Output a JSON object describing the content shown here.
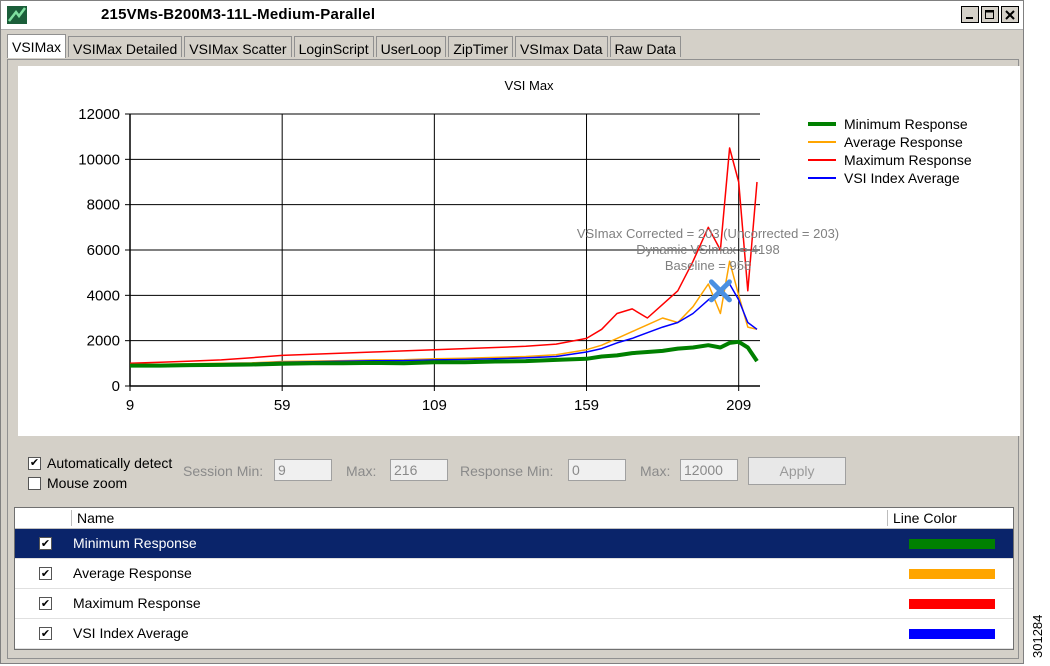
{
  "window": {
    "title": "215VMs-B200M3-11L-Medium-Parallel",
    "buttons": [
      "minimize-icon",
      "maximize-icon",
      "close-icon"
    ]
  },
  "tabs": [
    {
      "label": "VSIMax",
      "active": true
    },
    {
      "label": "VSIMax Detailed"
    },
    {
      "label": "VSIMax Scatter"
    },
    {
      "label": "LoginScript"
    },
    {
      "label": "UserLoop"
    },
    {
      "label": "ZipTimer"
    },
    {
      "label": "VSImax Data"
    },
    {
      "label": "Raw Data"
    }
  ],
  "chart_data": {
    "type": "line",
    "title": "VSI Max",
    "x_ticks": [
      9,
      59,
      109,
      159,
      209
    ],
    "y_ticks": [
      0,
      2000,
      4000,
      6000,
      8000,
      10000,
      12000
    ],
    "xlim": [
      9,
      216
    ],
    "ylim": [
      0,
      12000
    ],
    "grid": true,
    "legend_position": "top-right",
    "x": [
      9,
      19,
      29,
      39,
      49,
      59,
      69,
      79,
      89,
      99,
      109,
      119,
      129,
      139,
      149,
      159,
      164,
      169,
      174,
      179,
      184,
      189,
      194,
      199,
      203,
      206,
      209,
      212,
      215
    ],
    "series": [
      {
        "name": "Minimum Response",
        "color": "#008000",
        "values": [
          900,
          900,
          920,
          930,
          950,
          980,
          1000,
          1000,
          1020,
          1000,
          1050,
          1050,
          1080,
          1100,
          1150,
          1200,
          1300,
          1350,
          1450,
          1500,
          1550,
          1650,
          1700,
          1800,
          1700,
          1900,
          1950,
          1700,
          1100
        ]
      },
      {
        "name": "Average Response",
        "color": "#ffa500",
        "values": [
          950,
          960,
          980,
          1000,
          1020,
          1080,
          1100,
          1120,
          1150,
          1160,
          1200,
          1220,
          1260,
          1300,
          1380,
          1600,
          1800,
          2100,
          2400,
          2700,
          3000,
          2800,
          3500,
          4500,
          3200,
          5500,
          4000,
          2600,
          2500
        ]
      },
      {
        "name": "Maximum Response",
        "color": "#ff0000",
        "values": [
          1000,
          1050,
          1100,
          1150,
          1250,
          1350,
          1400,
          1450,
          1500,
          1550,
          1600,
          1650,
          1700,
          1750,
          1850,
          2100,
          2500,
          3200,
          3400,
          3000,
          3600,
          4200,
          5500,
          7000,
          6000,
          10500,
          9000,
          4200,
          9000
        ]
      },
      {
        "name": "VSI Index Average",
        "color": "#0000ff",
        "values": [
          920,
          930,
          950,
          980,
          1000,
          1050,
          1070,
          1090,
          1110,
          1120,
          1150,
          1170,
          1200,
          1240,
          1300,
          1500,
          1650,
          1900,
          2100,
          2350,
          2600,
          2800,
          3200,
          3800,
          4200,
          4500,
          3800,
          2800,
          2500
        ]
      }
    ],
    "marker": {
      "x": 203,
      "y": 4198
    },
    "annotations": [
      "VSImax Corrected = 203 (Uncorrected = 203)",
      "Dynamic VSImax = 4198",
      "Baseline = 958"
    ]
  },
  "controls": {
    "auto_detect_label": "Automatically detect",
    "auto_detect_checked": true,
    "mouse_zoom_label": "Mouse zoom",
    "mouse_zoom_checked": false,
    "session_min_label": "Session Min:",
    "session_min_value": "9",
    "session_max_label": "Max:",
    "session_max_value": "216",
    "response_min_label": "Response Min:",
    "response_min_value": "0",
    "response_max_label": "Max:",
    "response_max_value": "12000",
    "apply_label": "Apply"
  },
  "grid": {
    "columns": [
      "Name",
      "Line Color"
    ],
    "rows": [
      {
        "name": "Minimum Response",
        "checked": true,
        "color": "#008000",
        "selected": true
      },
      {
        "name": "Average Response",
        "checked": true,
        "color": "#ffa500",
        "selected": false
      },
      {
        "name": "Maximum Response",
        "checked": true,
        "color": "#ff0000",
        "selected": false
      },
      {
        "name": "VSI Index Average",
        "checked": true,
        "color": "#0000ff",
        "selected": false
      }
    ]
  },
  "figure_id": "301284"
}
